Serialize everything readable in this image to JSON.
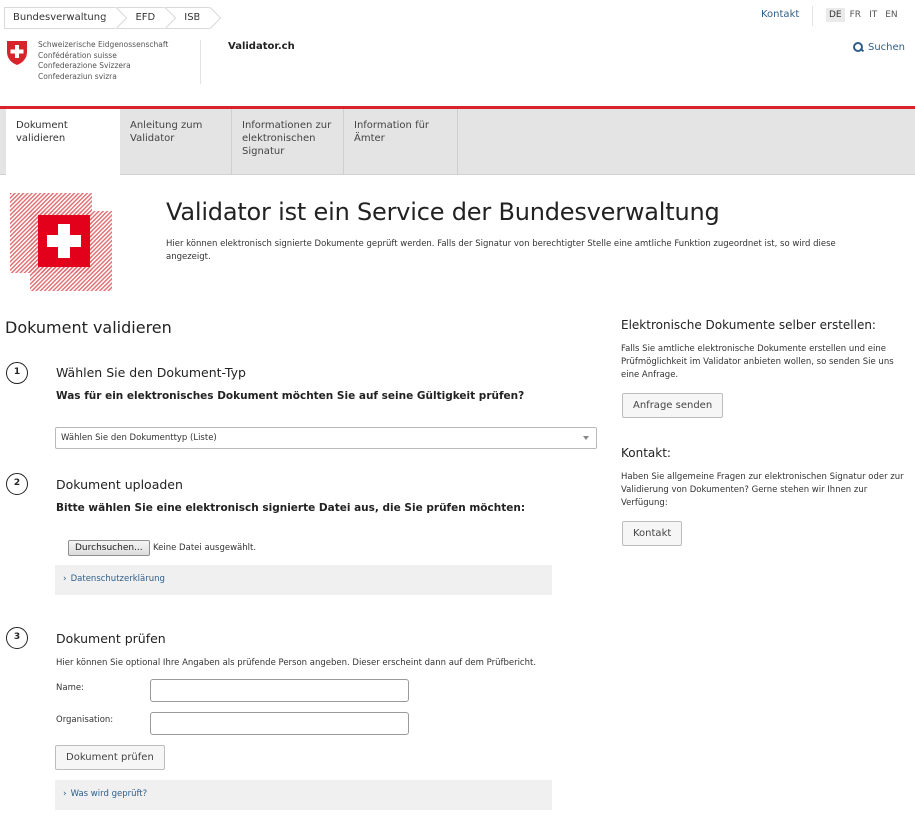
{
  "topbar": {
    "breadcrumbs": [
      "Bundesverwaltung",
      "EFD",
      "ISB"
    ],
    "contact_label": "Kontakt",
    "languages": [
      "DE",
      "FR",
      "IT",
      "EN"
    ],
    "active_language": "DE"
  },
  "header": {
    "brand_lines": [
      "Schweizerische Eidgenossenschaft",
      "Confédération suisse",
      "Confederazione Svizzera",
      "Confederaziun svizra"
    ],
    "site_title": "Validator.ch",
    "search_label": "Suchen",
    "accent_color": "#d8232a",
    "link_color": "#2f5e8a"
  },
  "nav": {
    "tabs": [
      {
        "label": "Dokument validieren"
      },
      {
        "label": "Anleitung zum Validator"
      },
      {
        "label": "Informationen zur elektronischen Signatur"
      },
      {
        "label": "Information für Ämter"
      }
    ]
  },
  "hero": {
    "title": "Validator ist ein Service der Bundesverwaltung",
    "subtitle": "Hier können elektronisch signierte Dokumente geprüft werden. Falls der Signatur von berechtigter Stelle eine amtliche Funktion zugeordnet ist, so wird diese angezeigt."
  },
  "main": {
    "heading": "Dokument validieren",
    "step1": {
      "number": "1",
      "title": "Wählen Sie den Dokument-Typ",
      "question": "Was für ein elektronisches Dokument möchten Sie auf seine Gültigkeit prüfen?",
      "select_value": "Wählen Sie den Dokumenttyp (Liste)"
    },
    "step2": {
      "number": "2",
      "title": "Dokument uploaden",
      "question": "Bitte wählen Sie eine elektronisch signierte Datei aus, die Sie prüfen möchten:",
      "browse_label": "Durchsuchen...",
      "no_file_label": "Keine Datei ausgewählt.",
      "privacy_link": "Datenschutzerklärung"
    },
    "step3": {
      "number": "3",
      "title": "Dokument prüfen",
      "hint": "Hier können Sie optional Ihre Angaben als prüfende Person angeben. Dieser erscheint dann auf dem Prüfbericht.",
      "name_label": "Name:",
      "name_value": "",
      "org_label": "Organisation:",
      "org_value": "",
      "submit_label": "Dokument prüfen",
      "what_checked_link": "Was wird geprüft?"
    }
  },
  "sidebar": {
    "create_heading": "Elektronische Dokumente selber erstellen:",
    "create_text": "Falls Sie amtliche elektronische Dokumente erstellen und eine Prüfmöglichkeit im Validator anbieten wollen, so senden Sie uns eine Anfrage.",
    "request_button": "Anfrage senden",
    "contact_heading": "Kontakt:",
    "contact_text": "Haben Sie allgemeine Fragen zur elektronischen Signatur oder zur Validierung von Dokumenten? Gerne stehen wir Ihnen zur Verfügung:",
    "contact_button": "Kontakt"
  }
}
